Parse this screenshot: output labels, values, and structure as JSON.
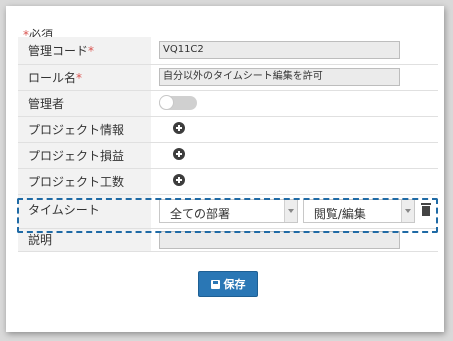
{
  "required_note": {
    "star": "*",
    "text": "必須"
  },
  "rows": {
    "code": {
      "label": "管理コード",
      "star": "*",
      "value": "VQ11C2"
    },
    "role": {
      "label": "ロール名",
      "star": "*",
      "value": "自分以外のタイムシート編集を許可"
    },
    "admin": {
      "label": "管理者",
      "toggle": "off"
    },
    "project_info": {
      "label": "プロジェクト情報"
    },
    "project_pl": {
      "label": "プロジェクト損益"
    },
    "project_hours": {
      "label": "プロジェクト工数"
    },
    "timesheet": {
      "label": "タイムシート",
      "department": "全ての部署",
      "permission": "閲覧/編集"
    },
    "description": {
      "label": "説明",
      "value": ""
    }
  },
  "save_button": {
    "label": "保存"
  },
  "colors": {
    "accent": "#2a77b5",
    "required": "#d9534f",
    "highlight": "#1f6aa5"
  }
}
